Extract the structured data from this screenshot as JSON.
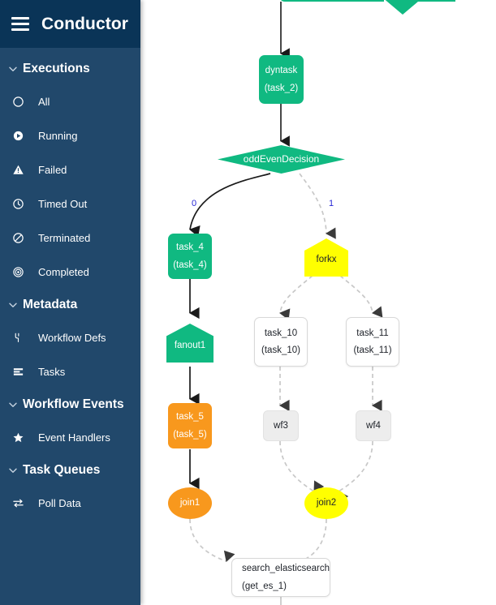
{
  "app": {
    "brand": "Conductor",
    "menu_icon": "hamburger-icon"
  },
  "sidebar": {
    "sections": [
      {
        "title": "Executions",
        "chevron": "chevron-down-icon",
        "items": [
          {
            "label": "All",
            "icon": "circle-icon"
          },
          {
            "label": "Running",
            "icon": "play-circle-icon"
          },
          {
            "label": "Failed",
            "icon": "warning-triangle-icon"
          },
          {
            "label": "Timed Out",
            "icon": "clock-icon"
          },
          {
            "label": "Terminated",
            "icon": "no-entry-icon"
          },
          {
            "label": "Completed",
            "icon": "target-circle-icon"
          }
        ]
      },
      {
        "title": "Metadata",
        "chevron": "chevron-down-icon",
        "items": [
          {
            "label": "Workflow Defs",
            "icon": "workflow-branch-icon"
          },
          {
            "label": "Tasks",
            "icon": "list-rows-icon"
          }
        ]
      },
      {
        "title": "Workflow Events",
        "chevron": "chevron-down-icon",
        "items": [
          {
            "label": "Event Handlers",
            "icon": "star-icon"
          }
        ]
      },
      {
        "title": "Task Queues",
        "chevron": "chevron-down-icon",
        "items": [
          {
            "label": "Poll Data",
            "icon": "exchange-arrows-icon"
          }
        ]
      }
    ]
  },
  "colors": {
    "sidebar_bg": "#21486b",
    "sidebar_header_bg": "#0a3457",
    "node_green": "#10b981",
    "node_orange": "#f8981d",
    "node_yellow": "#ffff00",
    "node_grey": "#ededed",
    "edge_label": "#2626d6",
    "edge_solid": "#1a1a1a",
    "edge_dashed": "#c8c8c8"
  },
  "graph": {
    "nodes": [
      {
        "id": "top_partial",
        "label": "",
        "sublabel": "",
        "shape": "diamond-partial",
        "status": "green"
      },
      {
        "id": "dyntask",
        "label": "dyntask",
        "sublabel": "(task_2)",
        "shape": "rect",
        "status": "green"
      },
      {
        "id": "oddEven",
        "label": "oddEvenDecision",
        "sublabel": "",
        "shape": "diamond",
        "status": "green"
      },
      {
        "id": "task_4",
        "label": "task_4",
        "sublabel": "(task_4)",
        "shape": "rect",
        "status": "green"
      },
      {
        "id": "forkx",
        "label": "forkx",
        "sublabel": "",
        "shape": "pentagon",
        "status": "yellow"
      },
      {
        "id": "task_10",
        "label": "task_10",
        "sublabel": "(task_10)",
        "shape": "rect",
        "status": "pending"
      },
      {
        "id": "task_11",
        "label": "task_11",
        "sublabel": "(task_11)",
        "shape": "rect",
        "status": "pending"
      },
      {
        "id": "fanout1",
        "label": "fanout1",
        "sublabel": "",
        "shape": "pentagon",
        "status": "green"
      },
      {
        "id": "wf3",
        "label": "wf3",
        "sublabel": "",
        "shape": "pill",
        "status": "grey"
      },
      {
        "id": "wf4",
        "label": "wf4",
        "sublabel": "",
        "shape": "pill",
        "status": "grey"
      },
      {
        "id": "task_5",
        "label": "task_5",
        "sublabel": "(task_5)",
        "shape": "rect",
        "status": "orange"
      },
      {
        "id": "join1",
        "label": "join1",
        "sublabel": "",
        "shape": "ellipse",
        "status": "orange"
      },
      {
        "id": "join2",
        "label": "join2",
        "sublabel": "",
        "shape": "ellipse",
        "status": "yellow"
      },
      {
        "id": "get_es_1",
        "label": "search_elasticsearch",
        "sublabel": "(get_es_1)",
        "shape": "rect",
        "status": "pending"
      }
    ],
    "edge_labels": [
      {
        "id": "branch_0",
        "text": "0"
      },
      {
        "id": "branch_1",
        "text": "1"
      }
    ]
  }
}
